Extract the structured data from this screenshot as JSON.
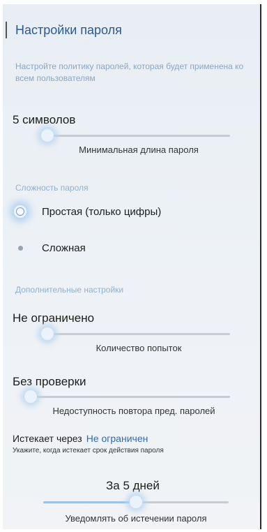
{
  "header": {
    "title": "Настройки пароля",
    "description": "Настройте политику паролей, которая будет применена ко всем пользователям"
  },
  "min_length": {
    "value_label": "5 символов",
    "caption": "Минимальная длина пароля",
    "level": 0.0
  },
  "complexity": {
    "section_title": "Сложность пароля",
    "options": [
      {
        "label": "Простая (только цифры)",
        "selected": true
      },
      {
        "label": "Сложная",
        "selected": false
      }
    ]
  },
  "extra": {
    "section_title": "Дополнительные настройки"
  },
  "attempts": {
    "value_label": "Не ограничено",
    "caption": "Количество попыток",
    "level": 0.0
  },
  "history": {
    "value_label": "Без проверки",
    "caption": "Недоступность повтора пред. паролей",
    "level": 0.0
  },
  "expiration": {
    "prefix": "Истекает через",
    "link": "Не ограничен",
    "hint": "Укажите, когда истекает срок действия пароля"
  },
  "notify": {
    "value_label": "За 5 дней",
    "caption": "Уведомлять об истечении пароля",
    "level": 0.5
  },
  "colors": {
    "accent": "#2e6bb0",
    "section": "#8fb0cf",
    "slider_fill": "#9bc3e8"
  }
}
